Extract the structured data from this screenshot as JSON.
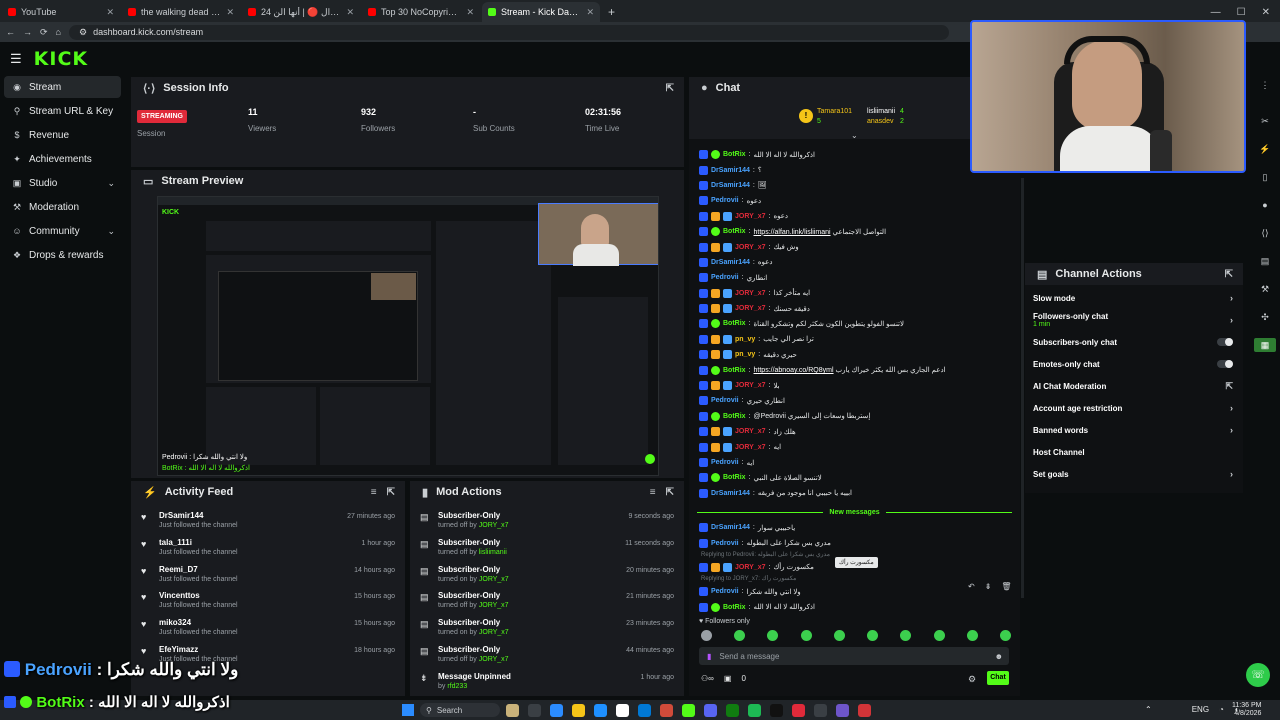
{
  "browser": {
    "tabs": [
      {
        "label": "YouTube",
        "color": "#ff0000"
      },
      {
        "label": "the walking dead s02 ep01 - 1⁄4",
        "color": "#ff0000"
      },
      {
        "label": "24 ساعه بدون جوال 🔴 | أنها الن",
        "color": "#ff0000"
      },
      {
        "label": "Top 30 NoCopyrightSounds | Be",
        "color": "#ff0000"
      },
      {
        "label": "Stream - Kick Dashboard",
        "color": "#53fc18"
      }
    ],
    "url": "dashboard.kick.com/stream"
  },
  "brand": {
    "logo": "KICK",
    "accent": "#53fc18"
  },
  "sidebar": {
    "items": [
      {
        "label": "Stream",
        "icon": "broadcast-icon",
        "glyph": "◉",
        "chev": ""
      },
      {
        "label": "Stream URL & Key",
        "icon": "link-icon",
        "glyph": "⚲",
        "chev": ""
      },
      {
        "label": "Revenue",
        "icon": "dollar-icon",
        "glyph": "$",
        "chev": ""
      },
      {
        "label": "Achievements",
        "icon": "trophy-icon",
        "glyph": "✦",
        "chev": ""
      },
      {
        "label": "Studio",
        "icon": "camera-icon",
        "glyph": "▣",
        "chev": "⌄"
      },
      {
        "label": "Moderation",
        "icon": "hammer-icon",
        "glyph": "⚒",
        "chev": ""
      },
      {
        "label": "Community",
        "icon": "people-icon",
        "glyph": "☺",
        "chev": "⌄"
      },
      {
        "label": "Drops & rewards",
        "icon": "gift-icon",
        "glyph": "❖",
        "chev": ""
      }
    ]
  },
  "session": {
    "title": "Session Info",
    "status": "STREAMING",
    "session_label": "Session",
    "viewers": "11",
    "viewers_label": "Viewers",
    "followers": "932",
    "followers_label": "Followers",
    "subs": "-",
    "subs_label": "Sub Counts",
    "time": "02:31:56",
    "time_label": "Time Live"
  },
  "preview": {
    "title": "Stream Preview",
    "overlay_line1": "Pedrovii : ولا انتي والله شكرا",
    "overlay_line2": "BotRix : اذكروالله لا اله الا الله"
  },
  "activity": {
    "title": "Activity Feed",
    "items": [
      {
        "name": "DrSamir144",
        "sub": "Just followed the channel",
        "time": "27 minutes ago"
      },
      {
        "name": "tala_111i",
        "sub": "Just followed the channel",
        "time": "1 hour ago"
      },
      {
        "name": "Reemi_D7",
        "sub": "Just followed the channel",
        "time": "14 hours ago"
      },
      {
        "name": "Vincenttos",
        "sub": "Just followed the channel",
        "time": "15 hours ago"
      },
      {
        "name": "miko324",
        "sub": "Just followed the channel",
        "time": "15 hours ago"
      },
      {
        "name": "EfeYimazz",
        "sub": "Just followed the channel",
        "time": "18 hours ago"
      }
    ]
  },
  "mod": {
    "title": "Mod Actions",
    "items": [
      {
        "name": "Subscriber-Only",
        "sub": "turned off by",
        "by": "JORY_x7",
        "time": "9 seconds ago"
      },
      {
        "name": "Subscriber-Only",
        "sub": "turned off by",
        "by": "lisliimanii",
        "time": "11 seconds ago"
      },
      {
        "name": "Subscriber-Only",
        "sub": "turned on by",
        "by": "JORY_x7",
        "time": "20 minutes ago"
      },
      {
        "name": "Subscriber-Only",
        "sub": "turned off by",
        "by": "JORY_x7",
        "time": "21 minutes ago"
      },
      {
        "name": "Subscriber-Only",
        "sub": "turned on by",
        "by": "JORY_x7",
        "time": "23 minutes ago"
      },
      {
        "name": "Subscriber-Only",
        "sub": "turned off by",
        "by": "JORY_x7",
        "time": "44 minutes ago"
      },
      {
        "name": "Message Unpinned",
        "sub": "by",
        "by": "rfd233",
        "time": "1 hour ago"
      }
    ]
  },
  "chat": {
    "title": "Chat",
    "leaders": [
      {
        "name": "Tamara101",
        "count": "5"
      },
      {
        "name": "lisliimanii",
        "count": "4"
      },
      {
        "name": "anasdev",
        "count": "2"
      }
    ],
    "messages": [
      {
        "user": "BotRix",
        "color": "#53fc18",
        "text": "اذكروالله لا اله الا الله"
      },
      {
        "user": "DrSamir144",
        "color": "#4aa3ff",
        "text": "؟"
      },
      {
        "user": "DrSamir144",
        "color": "#4aa3ff",
        "text": "🖼"
      },
      {
        "user": "Pedrovii",
        "color": "#4aa3ff",
        "text": "دعوه"
      },
      {
        "user": "JORY_x7",
        "color": "#e02a3a",
        "text": "دعوه"
      },
      {
        "user": "BotRix",
        "color": "#53fc18",
        "text": "التواصل الاجتماعي",
        "link": "https://alfan.link/lisliimani"
      },
      {
        "user": "JORY_x7",
        "color": "#e02a3a",
        "text": "وش فيك"
      },
      {
        "user": "DrSamir144",
        "color": "#4aa3ff",
        "text": "دعوه"
      },
      {
        "user": "Pedrovii",
        "color": "#4aa3ff",
        "text": "انطاري"
      },
      {
        "user": "JORY_x7",
        "color": "#e02a3a",
        "text": "ايه متأخر كذا"
      },
      {
        "user": "JORY_x7",
        "color": "#e02a3a",
        "text": "دقيقه حسنك"
      },
      {
        "user": "BotRix",
        "color": "#53fc18",
        "text": "لاتنسو الفولو يتطوين الكون شكثر لكم وتشكرو القناة"
      },
      {
        "user": "pn_vy",
        "color": "#f5c518",
        "text": "ترا نصر الي جايب"
      },
      {
        "user": "pn_vy",
        "color": "#f5c518",
        "text": "حيري دقيقه"
      },
      {
        "user": "BotRix",
        "color": "#53fc18",
        "text": "ادعم الجاري بس الله يكثر خيراك يارب",
        "link": "https://abnoay.co/RQ8yml"
      },
      {
        "user": "JORY_x7",
        "color": "#e02a3a",
        "text": "بلا"
      },
      {
        "user": "Pedrovii",
        "color": "#4aa3ff",
        "text": "انطاري حيري"
      },
      {
        "user": "BotRix",
        "color": "#53fc18",
        "text": "@Pedrovii إستربطا وسعات إلى السيري"
      },
      {
        "user": "JORY_x7",
        "color": "#e02a3a",
        "text": "هلك زاد"
      },
      {
        "user": "JORY_x7",
        "color": "#e02a3a",
        "text": "ايه"
      },
      {
        "user": "Pedrovii",
        "color": "#4aa3ff",
        "text": "ايه"
      },
      {
        "user": "BotRix",
        "color": "#53fc18",
        "text": "لاتنسو الصلاة على النبي"
      },
      {
        "user": "DrSamir144",
        "color": "#4aa3ff",
        "text": "ابييه يا حبيبي انا موجود من فريقه"
      }
    ],
    "new_label": "New messages",
    "new_messages": [
      {
        "user": "DrSamir144",
        "color": "#4aa3ff",
        "text": "ياحبيبي سوار"
      },
      {
        "user": "Pedrovii",
        "color": "#4aa3ff",
        "text": "مدري بس شكرا على البطوله"
      },
      {
        "reply": "Replying to Pedrovii: مدري بس شكرا على البطوله",
        "user": "JORY_x7",
        "color": "#e02a3a",
        "text": "مكسورت رأك"
      },
      {
        "reply": "Replying to JORY_x7: مكسورت رأك",
        "user": "Pedrovii",
        "color": "#4aa3ff",
        "text": "ولا انتي والله شكرا"
      },
      {
        "user": "BotRix",
        "color": "#53fc18",
        "text": "اذكروالله لا اله الا الله"
      }
    ],
    "tooltip": "مكسورت رأك",
    "followers_only": "Followers only",
    "input_placeholder": "Send a message",
    "chat_button": "Chat",
    "bottom_count": "0"
  },
  "actions": {
    "title": "Channel Actions",
    "items": [
      {
        "label": "Slow mode",
        "sub": "",
        "type": "arrow"
      },
      {
        "label": "Followers-only chat",
        "sub": "1 min",
        "type": "arrow"
      },
      {
        "label": "Subscribers-only chat",
        "sub": "",
        "type": "toggle"
      },
      {
        "label": "Emotes-only chat",
        "sub": "",
        "type": "toggle"
      },
      {
        "label": "AI Chat Moderation",
        "sub": "",
        "type": "external"
      },
      {
        "label": "Account age restriction",
        "sub": "",
        "type": "arrow"
      },
      {
        "label": "Banned words",
        "sub": "",
        "type": "arrow"
      },
      {
        "label": "Host Channel",
        "sub": "",
        "type": "none"
      },
      {
        "label": "Set goals",
        "sub": "",
        "type": "arrow"
      }
    ]
  },
  "overlay": {
    "line1_user": "Pedrovii",
    "line1_text": ": ولا انتي والله شكرا",
    "line2_user": "BotRix",
    "line2_text": ": اذكروالله لا اله الا الله"
  },
  "taskbar": {
    "search": "Search",
    "lang": "ENG",
    "time": "11:36 PM",
    "date": "4/8/2026"
  }
}
